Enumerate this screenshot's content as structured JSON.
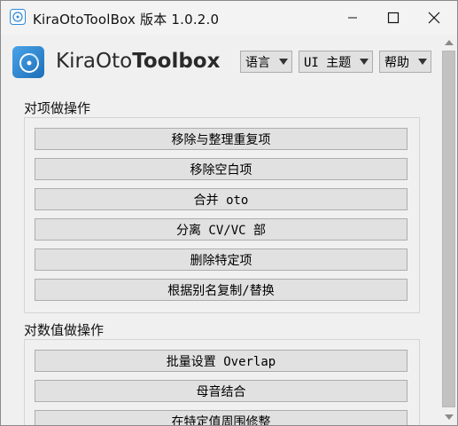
{
  "window": {
    "title": "KiraOtoToolBox 版本 1.0.2.0"
  },
  "brand": {
    "part1": "KiraOto",
    "part2": "Toolbox",
    "accent": "#2b88d8"
  },
  "menus": [
    {
      "label": "语言"
    },
    {
      "label": "UI 主题"
    },
    {
      "label": "帮助"
    }
  ],
  "sections": [
    {
      "title": "对项做操作",
      "buttons": [
        "移除与整理重复项",
        "移除空白项",
        "合并 oto",
        "分离 CV/VC 部",
        "删除特定项",
        "根据别名复制/替换"
      ]
    },
    {
      "title": "对数值做操作",
      "buttons": [
        "批量设置 Overlap",
        "母音结合",
        "在特定值周围修整"
      ]
    }
  ],
  "icons": {
    "app": "app-logo-icon",
    "minimize": "minimize-icon",
    "maximize": "maximize-icon",
    "close": "close-icon"
  }
}
